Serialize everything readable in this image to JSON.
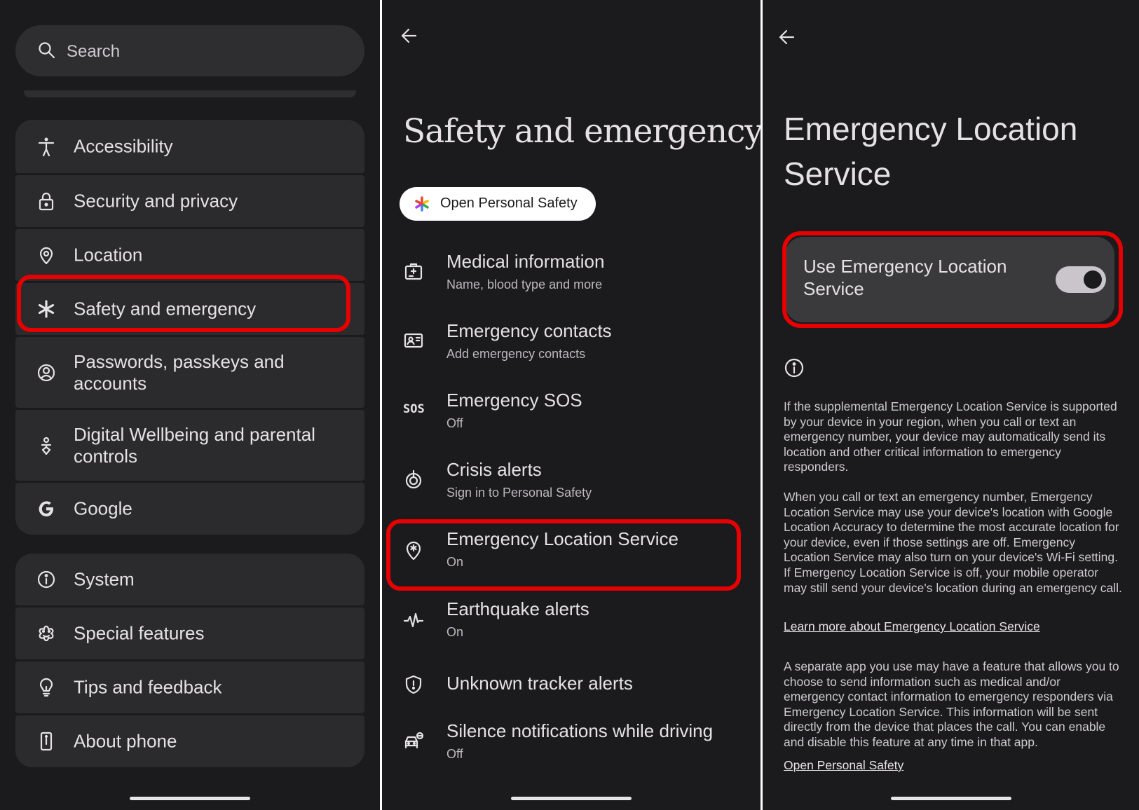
{
  "panel1": {
    "search": {
      "placeholder": "Search",
      "icon": "search-icon"
    },
    "group1": [
      {
        "label": "Accessibility",
        "icon": "accessibility-icon"
      },
      {
        "label": "Security and privacy",
        "icon": "lock-icon"
      },
      {
        "label": "Location",
        "icon": "location-pin-icon"
      },
      {
        "label": "Safety and emergency",
        "icon": "asterisk-icon",
        "highlighted": true
      },
      {
        "label": "Passwords, passkeys and accounts",
        "icon": "account-circle-icon"
      },
      {
        "label": "Digital Wellbeing and parental controls",
        "icon": "wellbeing-icon"
      },
      {
        "label": "Google",
        "icon": "google-g-icon"
      }
    ],
    "group2": [
      {
        "label": "System",
        "icon": "info-icon"
      },
      {
        "label": "Special features",
        "icon": "special-features-icon"
      },
      {
        "label": "Tips and feedback",
        "icon": "lightbulb-icon"
      },
      {
        "label": "About phone",
        "icon": "phone-icon"
      }
    ]
  },
  "panel2": {
    "title": "Safety and emergency",
    "chip": {
      "label": "Open Personal Safety",
      "icon": "personal-safety-icon"
    },
    "items": [
      {
        "title": "Medical information",
        "subtitle": "Name, blood type and more",
        "icon": "medical-id-icon"
      },
      {
        "title": "Emergency contacts",
        "subtitle": "Add emergency contacts",
        "icon": "contact-card-icon"
      },
      {
        "title": "Emergency SOS",
        "subtitle": "Off",
        "icon": "sos-icon",
        "icon_text": "SOS"
      },
      {
        "title": "Crisis alerts",
        "subtitle": "Sign in to Personal Safety",
        "icon": "crisis-alert-icon"
      },
      {
        "title": "Emergency Location Service",
        "subtitle": "On",
        "icon": "emergency-location-icon",
        "highlighted": true
      },
      {
        "title": "Earthquake alerts",
        "subtitle": "On",
        "icon": "earthquake-icon"
      },
      {
        "title": "Unknown tracker alerts",
        "subtitle": "",
        "icon": "tracker-shield-icon"
      },
      {
        "title": "Silence notifications while driving",
        "subtitle": "Off",
        "icon": "driving-icon"
      }
    ]
  },
  "panel3": {
    "title": "Emergency Location Service",
    "toggle": {
      "label": "Use Emergency Location Service",
      "state": "on"
    },
    "paragraph1": "If the supplemental Emergency Location Service is supported by your device in your region, when you call or text an emergency number, your device may automatically send its location and other critical information to emergency responders.",
    "paragraph2": "When you call or text an emergency number, Emergency Location Service may use your device's location with Google Location Accuracy to determine the most accurate location for your device, even if those settings are off. Emergency Location Service may also turn on your device's Wi-Fi setting. If Emergency Location Service is off, your mobile operator may still send your device's location during an emergency call.",
    "link1": "Learn more about Emergency Location Service",
    "paragraph3": "A separate app you use may have a feature that allows you to choose to send information such as medical and/or emergency contact information to emergency responders via Emergency Location Service. This information will be sent directly from the device that places the call. You can enable and disable this feature at any time in that app.",
    "link2": "Open Personal Safety"
  },
  "colors": {
    "background": "#1b1b1d",
    "card": "#2b2b2d",
    "highlight": "#e60000",
    "chip": "#ffffff",
    "toggle_track": "#c9c5ca"
  }
}
